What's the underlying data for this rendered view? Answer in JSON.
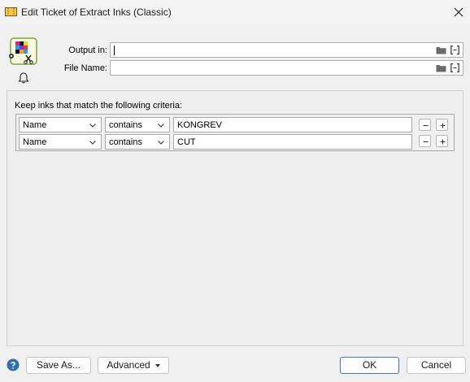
{
  "window": {
    "title": "Edit Ticket of Extract Inks (Classic)",
    "app_icon": "ticket-icon",
    "close_icon": "close-icon"
  },
  "output": {
    "label": "Output in:",
    "value": ""
  },
  "file_name": {
    "label": "File Name:",
    "value": ""
  },
  "criteria": {
    "label": "Keep inks that match the following criteria:",
    "rows": [
      {
        "field": "Name",
        "operator": "contains",
        "value": "KONGREV"
      },
      {
        "field": "Name",
        "operator": "contains",
        "value": "CUT"
      }
    ]
  },
  "footer": {
    "save_as": "Save As...",
    "advanced": "Advanced",
    "ok": "OK",
    "cancel": "Cancel"
  },
  "colors": {
    "accent": "#3b78c9",
    "help": "#2f6db4"
  }
}
